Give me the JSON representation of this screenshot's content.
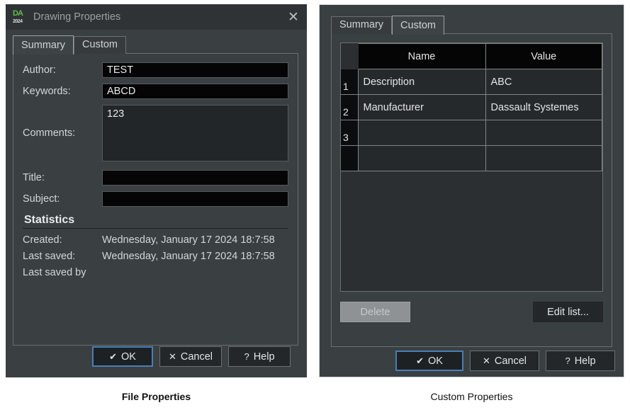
{
  "left_dialog": {
    "title": "Drawing Properties",
    "app_icon_glyph": "DA",
    "app_icon_year": "2024",
    "close_label": "✕",
    "tabs": [
      {
        "label": "Summary",
        "active": true
      },
      {
        "label": "Custom",
        "active": false
      }
    ],
    "fields": {
      "author_label": "Author:",
      "author_value": "TEST",
      "keywords_label": "Keywords:",
      "keywords_value": "ABCD",
      "comments_label": "Comments:",
      "comments_value": "123",
      "title_label": "Title:",
      "title_value": "",
      "subject_label": "Subject:",
      "subject_value": ""
    },
    "statistics": {
      "heading": "Statistics",
      "created_label": "Created:",
      "created_value": "Wednesday, January 17 2024 18:7:58",
      "last_saved_label": "Last saved:",
      "last_saved_value": "Wednesday, January 17 2024 18:7:58",
      "last_saved_by_label": "Last saved by",
      "last_saved_by_value": ""
    },
    "buttons": {
      "ok": "OK",
      "ok_icon": "✔",
      "cancel": "Cancel",
      "cancel_icon": "✕",
      "help": "Help",
      "help_icon": "?"
    }
  },
  "right_dialog": {
    "tabs": [
      {
        "label": "Summary",
        "active": false
      },
      {
        "label": "Custom",
        "active": true
      }
    ],
    "table": {
      "headers": [
        "",
        "Name",
        "Value"
      ],
      "rows": [
        {
          "num": "1",
          "name": "Description",
          "value": "ABC"
        },
        {
          "num": "2",
          "name": "Manufacturer",
          "value": "Dassault Systemes"
        },
        {
          "num": "3",
          "name": "",
          "value": ""
        }
      ]
    },
    "list_buttons": {
      "delete": "Delete",
      "edit_list": "Edit list..."
    },
    "buttons": {
      "ok": "OK",
      "ok_icon": "✔",
      "cancel": "Cancel",
      "cancel_icon": "✕",
      "help": "Help",
      "help_icon": "?"
    }
  },
  "captions": {
    "left": "File Properties",
    "right": "Custom Properties"
  },
  "colors": {
    "dialog_bg": "#3a3f41",
    "titlebar_bg": "#2f3335",
    "input_bg": "#050505",
    "accent_focus": "#4a7fb5",
    "icon_green": "#5fbf4a"
  }
}
